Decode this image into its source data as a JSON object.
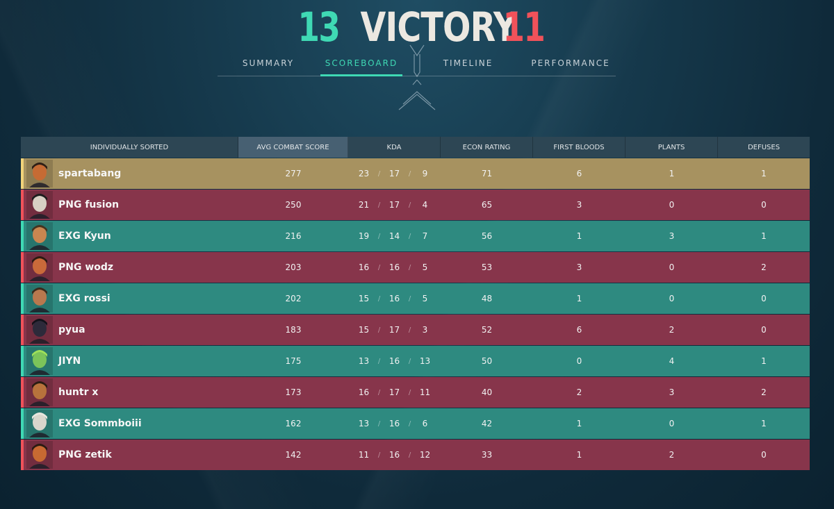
{
  "header": {
    "ally_score": "13",
    "result": "VICTORY",
    "enemy_score": "11",
    "colors": {
      "ally": "#3fd9b4",
      "enemy": "#f0525a",
      "self": "#a79260"
    }
  },
  "tabs": [
    {
      "label": "SUMMARY",
      "active": false
    },
    {
      "label": "SCOREBOARD",
      "active": true
    },
    {
      "label": "TIMELINE",
      "active": false
    },
    {
      "label": "PERFORMANCE",
      "active": false
    }
  ],
  "columns": {
    "name": "INDIVIDUALLY SORTED",
    "acs": "AVG COMBAT SCORE",
    "kda": "KDA",
    "econ": "ECON RATING",
    "first_bloods": "FIRST BLOODS",
    "plants": "PLANTS",
    "defuses": "DEFUSES"
  },
  "rows": [
    {
      "team": "self",
      "agent_icon": "agent-portrait-icon",
      "name": "spartabang",
      "acs": "277",
      "kills": "23",
      "deaths": "17",
      "assists": "9",
      "econ": "71",
      "first_bloods": "6",
      "plants": "1",
      "defuses": "1"
    },
    {
      "team": "enemy",
      "agent_icon": "agent-portrait-icon",
      "name": "PNG fusion",
      "acs": "250",
      "kills": "21",
      "deaths": "17",
      "assists": "4",
      "econ": "65",
      "first_bloods": "3",
      "plants": "0",
      "defuses": "0"
    },
    {
      "team": "ally",
      "agent_icon": "agent-portrait-icon",
      "name": "EXG Kyun",
      "acs": "216",
      "kills": "19",
      "deaths": "14",
      "assists": "7",
      "econ": "56",
      "first_bloods": "1",
      "plants": "3",
      "defuses": "1"
    },
    {
      "team": "enemy",
      "agent_icon": "agent-portrait-icon",
      "name": "PNG wodz",
      "acs": "203",
      "kills": "16",
      "deaths": "16",
      "assists": "5",
      "econ": "53",
      "first_bloods": "3",
      "plants": "0",
      "defuses": "2"
    },
    {
      "team": "ally",
      "agent_icon": "agent-portrait-icon",
      "name": "EXG rossi",
      "acs": "202",
      "kills": "15",
      "deaths": "16",
      "assists": "5",
      "econ": "48",
      "first_bloods": "1",
      "plants": "0",
      "defuses": "0"
    },
    {
      "team": "enemy",
      "agent_icon": "agent-portrait-icon",
      "name": "pyua",
      "acs": "183",
      "kills": "15",
      "deaths": "17",
      "assists": "3",
      "econ": "52",
      "first_bloods": "6",
      "plants": "2",
      "defuses": "0"
    },
    {
      "team": "ally",
      "agent_icon": "agent-portrait-icon",
      "name": "JIYN",
      "acs": "175",
      "kills": "13",
      "deaths": "16",
      "assists": "13",
      "econ": "50",
      "first_bloods": "0",
      "plants": "4",
      "defuses": "1"
    },
    {
      "team": "enemy",
      "agent_icon": "agent-portrait-icon",
      "name": "huntr x",
      "acs": "173",
      "kills": "16",
      "deaths": "17",
      "assists": "11",
      "econ": "40",
      "first_bloods": "2",
      "plants": "3",
      "defuses": "2"
    },
    {
      "team": "ally",
      "agent_icon": "agent-portrait-icon",
      "name": "EXG Sommboiii",
      "acs": "162",
      "kills": "13",
      "deaths": "16",
      "assists": "6",
      "econ": "42",
      "first_bloods": "1",
      "plants": "0",
      "defuses": "1"
    },
    {
      "team": "enemy",
      "agent_icon": "agent-portrait-icon",
      "name": "PNG zetik",
      "acs": "142",
      "kills": "11",
      "deaths": "16",
      "assists": "12",
      "econ": "33",
      "first_bloods": "1",
      "plants": "2",
      "defuses": "0"
    }
  ]
}
